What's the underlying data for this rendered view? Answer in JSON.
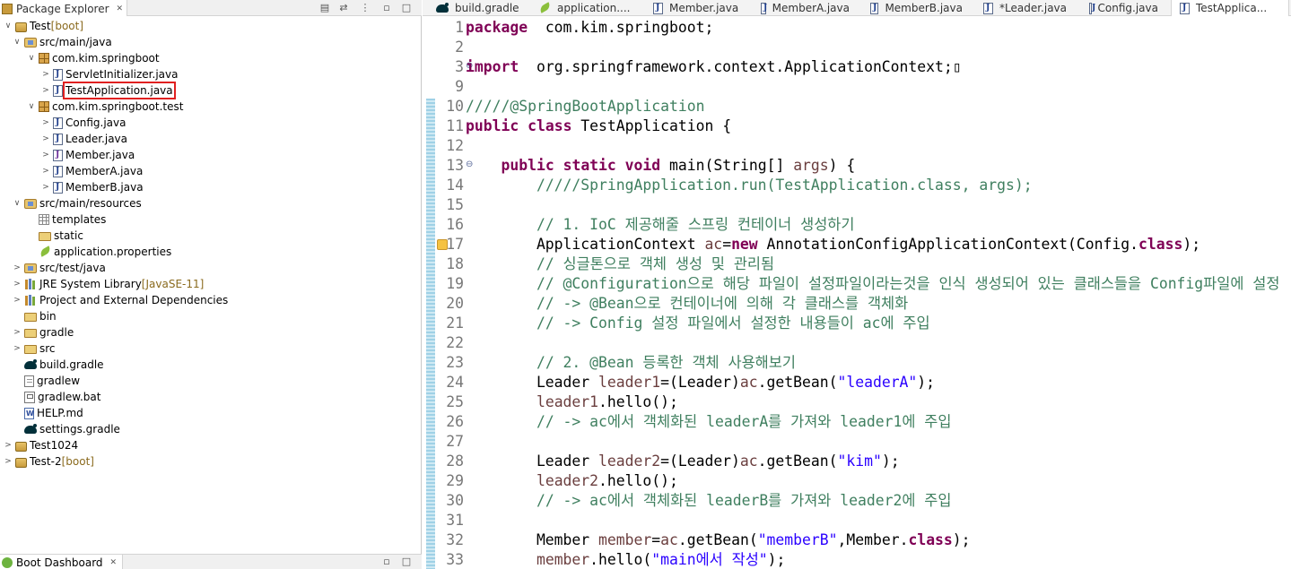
{
  "package_explorer": {
    "tab_label": "Package Explorer",
    "close_glyph": "✕",
    "tree": [
      {
        "label": "Test",
        "suffix": " [boot]",
        "icon": "project-icon",
        "arrow": "∨",
        "level": 0
      },
      {
        "label": "src/main/java",
        "icon": "source-folder-icon",
        "arrow": "∨",
        "level": 1
      },
      {
        "label": "com.kim.springboot",
        "icon": "package-icon",
        "arrow": "∨",
        "level": 2
      },
      {
        "label": "ServletInitializer.java",
        "icon": "java-file-icon",
        "arrow": ">",
        "level": 3
      },
      {
        "label": "TestApplication.java",
        "icon": "java-file-icon",
        "arrow": ">",
        "level": 3,
        "highlighted": true
      },
      {
        "label": "com.kim.springboot.test",
        "icon": "package-icon",
        "arrow": "∨",
        "level": 2
      },
      {
        "label": "Config.java",
        "icon": "java-file-icon",
        "arrow": ">",
        "level": 3
      },
      {
        "label": "Leader.java",
        "icon": "java-file-icon",
        "arrow": ">",
        "level": 3
      },
      {
        "label": "Member.java",
        "icon": "java-interface-file-icon",
        "arrow": ">",
        "level": 3
      },
      {
        "label": "MemberA.java",
        "icon": "java-file-icon",
        "arrow": ">",
        "level": 3
      },
      {
        "label": "MemberB.java",
        "icon": "java-file-icon",
        "arrow": ">",
        "level": 3
      },
      {
        "label": "src/main/resources",
        "icon": "source-folder-icon",
        "arrow": "∨",
        "level": 1
      },
      {
        "label": "templates",
        "icon": "folder-grid-icon",
        "arrow": "",
        "level": 2
      },
      {
        "label": "static",
        "icon": "folder-icon",
        "arrow": "",
        "level": 2
      },
      {
        "label": "application.properties",
        "icon": "properties-file-icon",
        "arrow": "",
        "level": 2
      },
      {
        "label": "src/test/java",
        "icon": "source-folder-icon",
        "arrow": ">",
        "level": 1
      },
      {
        "label": "JRE System Library",
        "suffix": " [JavaSE-11]",
        "icon": "library-icon",
        "arrow": ">",
        "level": 1
      },
      {
        "label": "Project and External Dependencies",
        "icon": "library-icon",
        "arrow": ">",
        "level": 1
      },
      {
        "label": "bin",
        "icon": "folder-icon",
        "arrow": "",
        "level": 1
      },
      {
        "label": "gradle",
        "icon": "folder-icon",
        "arrow": ">",
        "level": 1
      },
      {
        "label": "src",
        "icon": "folder-icon",
        "arrow": ">",
        "level": 1
      },
      {
        "label": "build.gradle",
        "icon": "gradle-icon",
        "arrow": "",
        "level": 1
      },
      {
        "label": "gradlew",
        "icon": "file-icon",
        "arrow": "",
        "level": 1
      },
      {
        "label": "gradlew.bat",
        "icon": "bat-file-icon",
        "arrow": "",
        "level": 1
      },
      {
        "label": "HELP.md",
        "icon": "md-file-icon",
        "arrow": "",
        "level": 1
      },
      {
        "label": "settings.gradle",
        "icon": "gradle-icon",
        "arrow": "",
        "level": 1
      },
      {
        "label": "Test1024",
        "icon": "project-icon",
        "arrow": ">",
        "level": 0
      },
      {
        "label": "Test-2",
        "suffix": " [boot]",
        "icon": "project-icon",
        "arrow": ">",
        "level": 0
      }
    ]
  },
  "boot_dashboard": {
    "tab_label": "Boot Dashboard",
    "close_glyph": "✕"
  },
  "editor": {
    "tabs": [
      {
        "label": "build.gradle",
        "icon": "gradle-icon",
        "active": false
      },
      {
        "label": "application....",
        "icon": "properties-file-icon",
        "active": false
      },
      {
        "label": "Member.java",
        "icon": "java-file-icon",
        "active": false
      },
      {
        "label": "MemberA.java",
        "icon": "java-file-icon",
        "active": false
      },
      {
        "label": "MemberB.java",
        "icon": "java-file-icon",
        "active": false
      },
      {
        "label": "*Leader.java",
        "icon": "java-file-icon",
        "active": false
      },
      {
        "label": "Config.java",
        "icon": "java-file-icon",
        "active": false
      },
      {
        "label": "TestApplica...",
        "icon": "java-file-icon",
        "active": true
      }
    ],
    "lines": [
      {
        "n": "1",
        "tokens": [
          [
            "kw",
            "package"
          ],
          [
            "",
            "  com.kim.springboot;"
          ]
        ]
      },
      {
        "n": "2",
        "tokens": []
      },
      {
        "n": "3",
        "fold": "⊕",
        "tokens": [
          [
            "kw",
            "import"
          ],
          [
            "",
            "  org.springframework.context.ApplicationContext;▯"
          ]
        ]
      },
      {
        "n": "9",
        "tokens": []
      },
      {
        "n": "10",
        "tokens": [
          [
            "cm",
            "/////@SpringBootApplication"
          ]
        ]
      },
      {
        "n": "11",
        "tokens": [
          [
            "kw",
            "public"
          ],
          [
            "",
            " "
          ],
          [
            "kw",
            "class"
          ],
          [
            "",
            " TestApplication {"
          ]
        ]
      },
      {
        "n": "12",
        "tokens": []
      },
      {
        "n": "13",
        "fold": "⊖",
        "tokens": [
          [
            "",
            "    "
          ],
          [
            "kw",
            "public"
          ],
          [
            "",
            " "
          ],
          [
            "kw",
            "static"
          ],
          [
            "",
            " "
          ],
          [
            "kw",
            "void"
          ],
          [
            "",
            " main(String[] "
          ],
          [
            "var",
            "args"
          ],
          [
            "",
            ") {"
          ]
        ]
      },
      {
        "n": "14",
        "tokens": [
          [
            "",
            "        "
          ],
          [
            "cm",
            "/////SpringApplication.run(TestApplication.class, args);"
          ]
        ]
      },
      {
        "n": "15",
        "tokens": []
      },
      {
        "n": "16",
        "tokens": [
          [
            "",
            "        "
          ],
          [
            "cm",
            "// 1. IoC 제공해줄 스프링 컨테이너 생성하기"
          ]
        ]
      },
      {
        "n": "17",
        "warn": true,
        "tokens": [
          [
            "",
            "        ApplicationContext "
          ],
          [
            "var",
            "ac"
          ],
          [
            "",
            "="
          ],
          [
            "kw",
            "new"
          ],
          [
            "",
            " AnnotationConfigApplicationContext(Config."
          ],
          [
            "kw",
            "class"
          ],
          [
            "",
            ");"
          ]
        ]
      },
      {
        "n": "18",
        "tokens": [
          [
            "",
            "        "
          ],
          [
            "cm",
            "// 싱글톤으로 객체 생성 및 관리됨"
          ]
        ]
      },
      {
        "n": "19",
        "tokens": [
          [
            "",
            "        "
          ],
          [
            "cm",
            "// @Configuration으로 해당 파일이 설정파일이라는것을 인식 생성되어 있는 클래스들을 Config파일에 설정"
          ]
        ]
      },
      {
        "n": "20",
        "tokens": [
          [
            "",
            "        "
          ],
          [
            "cm",
            "// -> @Bean으로 컨테이너에 의해 각 클래스를 객체화"
          ]
        ]
      },
      {
        "n": "21",
        "tokens": [
          [
            "",
            "        "
          ],
          [
            "cm",
            "// -> Config 설정 파일에서 설정한 내용들이 ac에 주입"
          ]
        ]
      },
      {
        "n": "22",
        "tokens": []
      },
      {
        "n": "23",
        "tokens": [
          [
            "",
            "        "
          ],
          [
            "cm",
            "// 2. @Bean 등록한 객체 사용해보기"
          ]
        ]
      },
      {
        "n": "24",
        "tokens": [
          [
            "",
            "        Leader "
          ],
          [
            "var",
            "leader1"
          ],
          [
            "",
            "=(Leader)"
          ],
          [
            "var",
            "ac"
          ],
          [
            "",
            ".getBean("
          ],
          [
            "str",
            "\"leaderA\""
          ],
          [
            "",
            ");"
          ]
        ]
      },
      {
        "n": "25",
        "tokens": [
          [
            "",
            "        "
          ],
          [
            "var",
            "leader1"
          ],
          [
            "",
            ".hello();"
          ]
        ]
      },
      {
        "n": "26",
        "tokens": [
          [
            "",
            "        "
          ],
          [
            "cm",
            "// -> ac에서 객체화된 leaderA를 가져와 leader1에 주입"
          ]
        ]
      },
      {
        "n": "27",
        "tokens": []
      },
      {
        "n": "28",
        "tokens": [
          [
            "",
            "        Leader "
          ],
          [
            "var",
            "leader2"
          ],
          [
            "",
            "=(Leader)"
          ],
          [
            "var",
            "ac"
          ],
          [
            "",
            ".getBean("
          ],
          [
            "str",
            "\"kim\""
          ],
          [
            "",
            ");"
          ]
        ]
      },
      {
        "n": "29",
        "tokens": [
          [
            "",
            "        "
          ],
          [
            "var",
            "leader2"
          ],
          [
            "",
            ".hello();"
          ]
        ]
      },
      {
        "n": "30",
        "tokens": [
          [
            "",
            "        "
          ],
          [
            "cm",
            "// -> ac에서 객체화된 leaderB를 가져와 leader2에 주입"
          ]
        ]
      },
      {
        "n": "31",
        "tokens": []
      },
      {
        "n": "32",
        "tokens": [
          [
            "",
            "        Member "
          ],
          [
            "var",
            "member"
          ],
          [
            "",
            "="
          ],
          [
            "var",
            "ac"
          ],
          [
            "",
            ".getBean("
          ],
          [
            "str",
            "\"memberB\""
          ],
          [
            "",
            ",Member."
          ],
          [
            "kw",
            "class"
          ],
          [
            "",
            ");"
          ]
        ]
      },
      {
        "n": "33",
        "tokens": [
          [
            "",
            "        "
          ],
          [
            "var",
            "member"
          ],
          [
            "",
            ".hello("
          ],
          [
            "str",
            "\"main에서 작성\""
          ],
          [
            "",
            ");"
          ]
        ]
      }
    ]
  },
  "colors": {
    "keyword": "#7f0055",
    "comment": "#3f7f5f",
    "string": "#2a00ff",
    "local_var": "#6a3e3e",
    "highlight_box": "#e02020"
  }
}
